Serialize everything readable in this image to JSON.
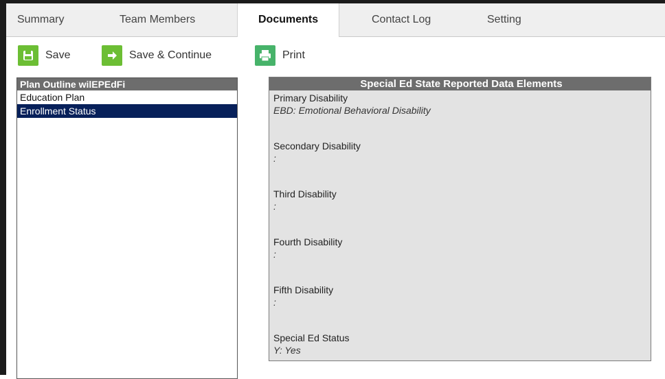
{
  "tabs": [
    {
      "label": "Summary"
    },
    {
      "label": "Team Members"
    },
    {
      "label": "Documents"
    },
    {
      "label": "Contact Log"
    },
    {
      "label": "Setting"
    }
  ],
  "active_tab": "Documents",
  "toolbar": {
    "save_label": "Save",
    "save_continue_label": "Save & Continue",
    "print_label": "Print"
  },
  "outline": {
    "header": "Plan Outline wilEPEdFi",
    "items": [
      {
        "label": "Education Plan"
      },
      {
        "label": "Enrollment Status"
      }
    ],
    "selected": "Enrollment Status"
  },
  "detail": {
    "header": "Special Ed State Reported Data Elements",
    "fields": [
      {
        "label": "Primary Disability",
        "value": "EBD: Emotional Behavioral Disability"
      },
      {
        "label": "Secondary Disability",
        "value": ":"
      },
      {
        "label": "Third Disability",
        "value": ":"
      },
      {
        "label": "Fourth Disability",
        "value": ":"
      },
      {
        "label": "Fifth Disability",
        "value": ":"
      },
      {
        "label": "Special Ed Status",
        "value": "Y: Yes"
      }
    ]
  },
  "colors": {
    "toolbar_icon_green": "#6cbe34",
    "selected_row": "#07205a",
    "panel_header": "#6d6d6d",
    "panel_bg": "#e3e3e3"
  }
}
